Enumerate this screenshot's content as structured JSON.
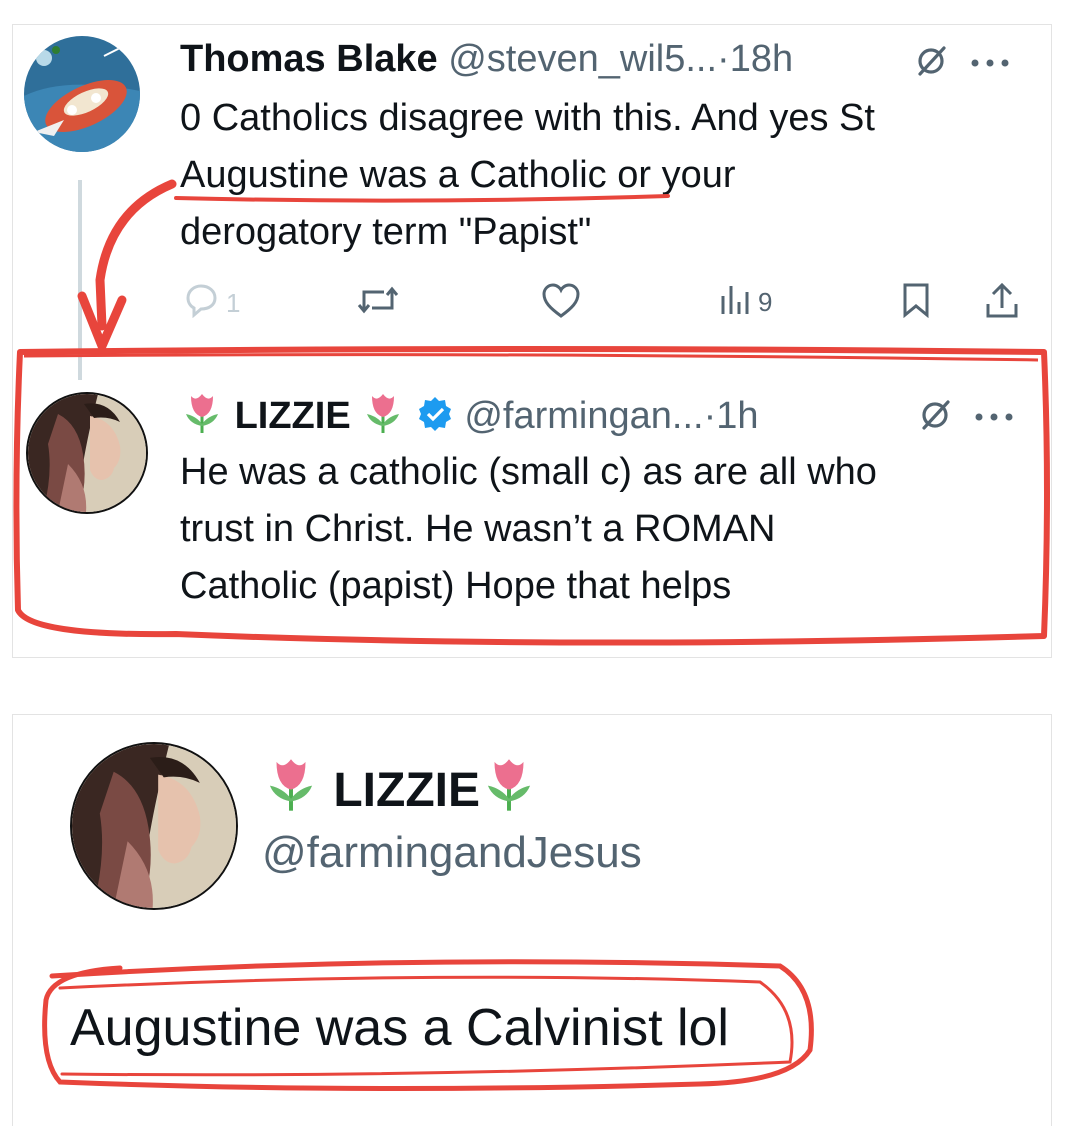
{
  "tweet1": {
    "display_name": "Thomas Blake",
    "handle": "@steven_wil5...",
    "separator": "·",
    "time": "18h",
    "text_lines": [
      "0 Catholics disagree with this. And yes St",
      "Augustine was a Catholic or your",
      "derogatory term \"Papist\""
    ],
    "replies_count": "1",
    "views_count": "9"
  },
  "tweet2": {
    "display_name": "LIZZIE",
    "handle": "@farmingan...",
    "separator": "·",
    "time": "1h",
    "text_lines": [
      "He was a catholic (small c) as are all who",
      "trust in Christ. He wasn’t a ROMAN",
      "Catholic (papist) Hope that helps"
    ]
  },
  "profile": {
    "display_name": "LIZZIE",
    "handle": "@farmingandJesus",
    "text": "Augustine was a Calvinist lol"
  },
  "colors": {
    "annotation_red": "#e8453c",
    "verified_blue": "#1d9bf0",
    "muted": "#536471"
  }
}
